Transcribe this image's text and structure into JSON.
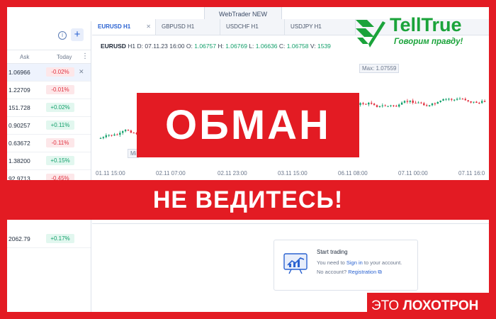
{
  "platform": {
    "top_button": "WebTrader NEW"
  },
  "watchlist": {
    "columns": [
      "Ask",
      "Today"
    ],
    "rows": [
      {
        "ask": "1.06966",
        "change": "-0.02%",
        "dir": "neg",
        "selected": true
      },
      {
        "ask": "1.22709",
        "change": "-0.01%",
        "dir": "neg"
      },
      {
        "ask": "151.728",
        "change": "+0.02%",
        "dir": "pos"
      },
      {
        "ask": "0.90257",
        "change": "+0.11%",
        "dir": "pos"
      },
      {
        "ask": "0.63672",
        "change": "-0.11%",
        "dir": "neg"
      },
      {
        "ask": "1.38200",
        "change": "+0.15%",
        "dir": "pos"
      },
      {
        "ask": "92.9713",
        "change": "-0.45%",
        "dir": "neg"
      },
      {
        "ask": "2062.79",
        "change": "+0.17%",
        "dir": "pos"
      }
    ]
  },
  "tabs": [
    {
      "label": "EURUSD H1",
      "active": true
    },
    {
      "label": "GBPUSD H1"
    },
    {
      "label": "USDCHF H1"
    },
    {
      "label": "USDJPY H1"
    }
  ],
  "legend": {
    "symbol": "EURUSD",
    "timeframe": "H1",
    "d_label": "D:",
    "d_value": "07.11.23 16:00",
    "o_label": "O:",
    "o_value": "1.06757",
    "h_label": "H:",
    "h_value": "1.06769",
    "l_label": "L:",
    "l_value": "1.06636",
    "c_label": "C:",
    "c_value": "1.06758",
    "v_label": "V:",
    "v_value": "1539"
  },
  "chart": {
    "max_tag": "Max: 1.07559",
    "min_tag": "Mi",
    "x_ticks": [
      "01.11 15:00",
      "02.11 07:00",
      "02.11 23:00",
      "03.11 15:00",
      "06.11 08:00",
      "07.11 00:00",
      "07.11 16:0"
    ]
  },
  "start_trading": {
    "title": "Start trading",
    "line1_pre": "You need to",
    "sign_in": "Sign in",
    "line1_post": "to your account.",
    "line2_pre": "No account?",
    "registration": "Registration"
  },
  "overlay": {
    "fake": "ОБМАН",
    "warning": "НЕ ВЕДИТЕСЬ!",
    "scam_prefix": "ЭТО",
    "scam_word": "ЛОХОТРОН"
  },
  "brand": {
    "name": "TellTrue",
    "slogan": "Говорим правду!",
    "color": "#1aa33a"
  },
  "colors": {
    "red": "#e31b23",
    "accent": "#2a62d1",
    "up": "#13a06b",
    "down": "#e0303f"
  }
}
